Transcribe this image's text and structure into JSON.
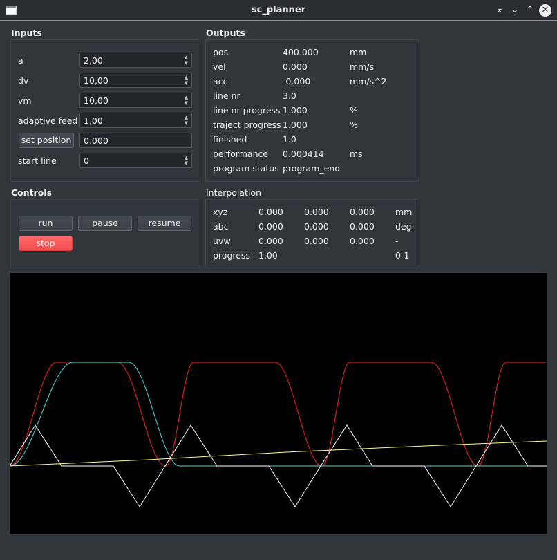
{
  "window": {
    "title": "sc_planner"
  },
  "inputs": {
    "title": "Inputs",
    "a": {
      "label": "a",
      "value": "2,00"
    },
    "dv": {
      "label": "dv",
      "value": "10,00"
    },
    "vm": {
      "label": "vm",
      "value": "10,00"
    },
    "adaptive_feed": {
      "label": "adaptive feed",
      "value": "1,00"
    },
    "set_position": {
      "button": "set position",
      "value": "0.000"
    },
    "start_line": {
      "label": "start line",
      "value": "0"
    }
  },
  "outputs": {
    "title": "Outputs",
    "rows": [
      {
        "label": "pos",
        "value": "400.000",
        "unit": "mm"
      },
      {
        "label": "vel",
        "value": "0.000",
        "unit": "mm/s"
      },
      {
        "label": "acc",
        "value": "-0.000",
        "unit": "mm/s^2"
      },
      {
        "label": "line nr",
        "value": "3.0",
        "unit": ""
      },
      {
        "label": "line nr progress",
        "value": "1.000",
        "unit": "%"
      },
      {
        "label": "traject progress",
        "value": "1.000",
        "unit": "%"
      },
      {
        "label": "finished",
        "value": "1.0",
        "unit": ""
      },
      {
        "label": "performance",
        "value": "0.000414",
        "unit": "ms"
      },
      {
        "label": "program status",
        "value": "program_end",
        "unit": ""
      }
    ]
  },
  "controls": {
    "title": "Controls",
    "run": "run",
    "pause": "pause",
    "resume": "resume",
    "stop": "stop"
  },
  "interpolation": {
    "title": "Interpolation",
    "rows": [
      {
        "label": "xyz",
        "v1": "0.000",
        "v2": "0.000",
        "v3": "0.000",
        "unit": "mm"
      },
      {
        "label": "abc",
        "v1": "0.000",
        "v2": "0.000",
        "v3": "0.000",
        "unit": "deg"
      },
      {
        "label": "uvw",
        "v1": "0.000",
        "v2": "0.000",
        "v3": "0.000",
        "unit": "-"
      },
      {
        "label": "progress",
        "v1": "1.00",
        "v2": "",
        "v3": "",
        "unit": "0-1"
      }
    ]
  },
  "plot": {
    "colors": {
      "background": "#000000",
      "velocity": "#ff2020",
      "position": "#40e0e0",
      "acceleration": "#ffffff",
      "progress": "#ffff80"
    }
  }
}
